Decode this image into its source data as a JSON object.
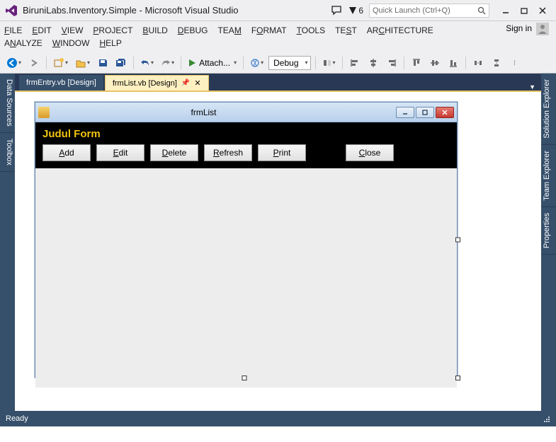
{
  "titlebar": {
    "app_title": "BiruniLabs.Inventory.Simple - Microsoft Visual Studio",
    "notification_count": "6",
    "search_placeholder": "Quick Launch (Ctrl+Q)"
  },
  "account": {
    "signin": "Sign in"
  },
  "menu": {
    "row1": [
      {
        "u": "F",
        "rest": "ILE"
      },
      {
        "u": "E",
        "rest": "DIT"
      },
      {
        "u": "V",
        "rest": "IEW"
      },
      {
        "u": "P",
        "rest": "ROJECT"
      },
      {
        "u": "B",
        "rest": "UILD"
      },
      {
        "u": "D",
        "rest": "EBUG"
      },
      {
        "u": "",
        "rest": "TEA",
        "u2": "M",
        "rest2": ""
      },
      {
        "u": "",
        "rest": "F",
        "u2": "O",
        "rest2": "RMAT"
      },
      {
        "u": "T",
        "rest": "OOLS"
      },
      {
        "u": "",
        "rest": "TE",
        "u2": "S",
        "rest2": "T"
      },
      {
        "u": "",
        "rest": "AR",
        "u2": "C",
        "rest2": "HITECTURE"
      }
    ],
    "row2": [
      {
        "u": "",
        "rest": "A",
        "u2": "N",
        "rest2": "ALYZE"
      },
      {
        "u": "W",
        "rest": "INDOW"
      },
      {
        "u": "H",
        "rest": "ELP"
      }
    ]
  },
  "toolbar": {
    "attach_label": "Attach...",
    "config": "Debug"
  },
  "side_tabs_left": [
    "Data Sources",
    "Toolbox"
  ],
  "side_tabs_right": [
    "Solution Explorer",
    "Team Explorer",
    "Properties"
  ],
  "editor_tabs": {
    "inactive": "frmEntry.vb [Design]",
    "active": "frmList.vb [Design]"
  },
  "designer_form": {
    "caption": "frmList",
    "title_label": "Judul Form",
    "buttons": {
      "add": {
        "u": "A",
        "rest": "dd"
      },
      "edit": {
        "u": "E",
        "rest": "dit"
      },
      "delete": {
        "u": "D",
        "rest": "elete"
      },
      "refresh": {
        "u": "R",
        "rest": "efresh"
      },
      "print": {
        "u": "P",
        "rest": "rint"
      },
      "close": {
        "u": "C",
        "rest": "lose"
      }
    }
  },
  "statusbar": {
    "text": "Ready"
  }
}
